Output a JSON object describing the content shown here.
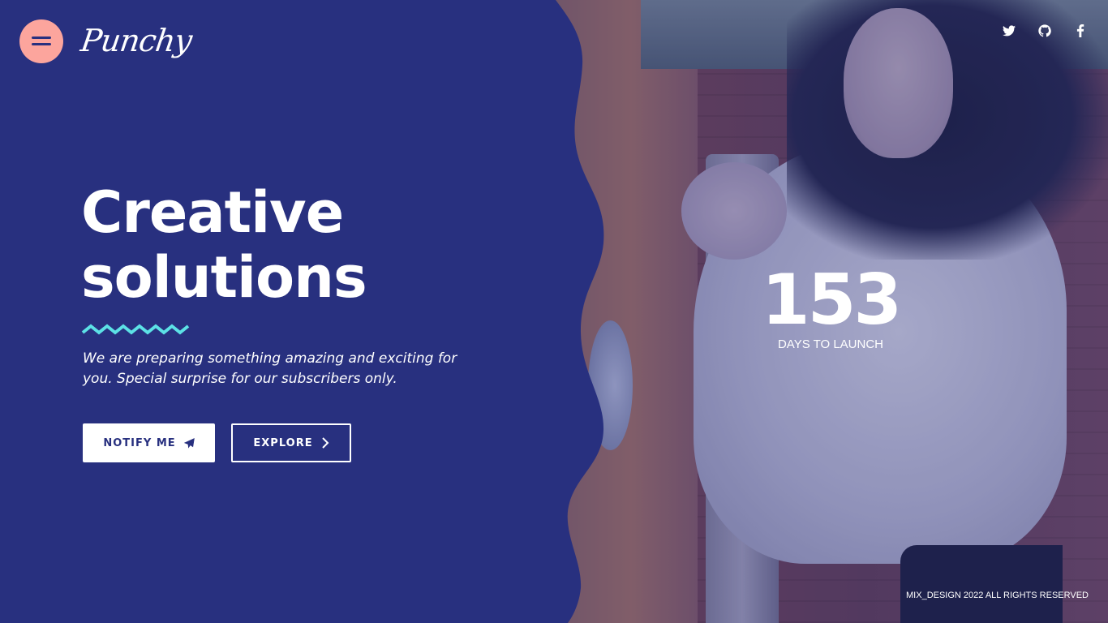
{
  "header": {
    "logo_text": "Punchy",
    "menu_icon": "hamburger-icon",
    "social": [
      {
        "name": "twitter-icon"
      },
      {
        "name": "github-icon"
      },
      {
        "name": "facebook-icon"
      }
    ]
  },
  "hero": {
    "headline_line1": "Creative",
    "headline_line2": "solutions",
    "subtitle": "We are preparing something amazing and exciting for you. Special surprise for our subscribers only.",
    "notify_label": "NOTIFY ME",
    "notify_icon": "paper-plane-icon",
    "explore_label": "EXPLORE",
    "explore_icon": "chevron-right-icon"
  },
  "countdown": {
    "days": "153",
    "label": "DAYS TO LAUNCH"
  },
  "footer": {
    "copyright": "MIX_DESIGN 2022 ALL RIGHTS RESERVED"
  },
  "colors": {
    "primary": "#28307f",
    "accent_pink": "#fca59d",
    "accent_cyan": "#5ce1e6",
    "text": "#ffffff"
  }
}
